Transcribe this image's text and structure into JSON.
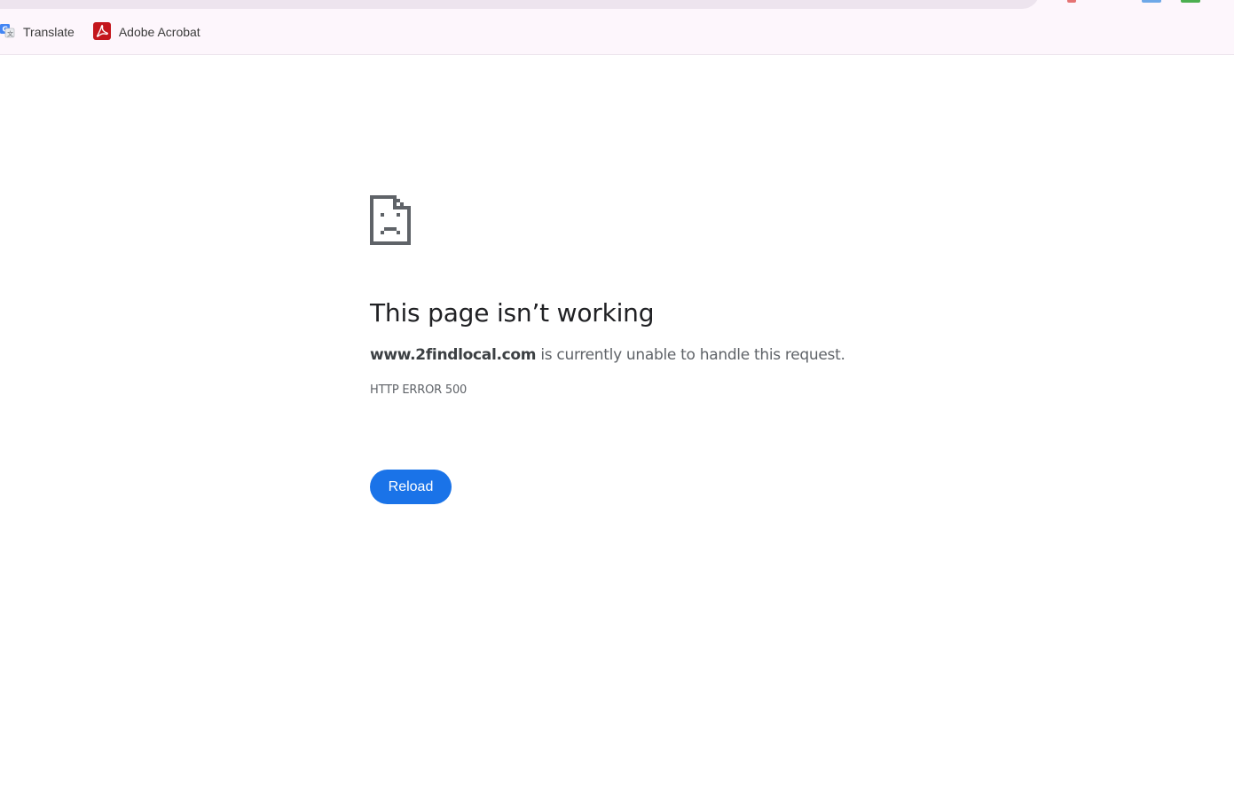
{
  "bookmarks": [
    {
      "label": "Translate",
      "icon": "google-translate-icon"
    },
    {
      "label": "Adobe Acrobat",
      "icon": "adobe-acrobat-icon"
    }
  ],
  "error": {
    "icon": "sad-page-icon",
    "title": "This page isn’t working",
    "domain": "www.2findlocal.com",
    "message_suffix": " is currently unable to handle this request.",
    "code": "HTTP ERROR 500",
    "reload_label": "Reload"
  },
  "colors": {
    "toolbar_bg": "#fdf6fc",
    "omnibox_bg": "#ede4ee",
    "title": "#202124",
    "body_text": "#5f6368",
    "button_bg": "#1a73e8",
    "button_text": "#ffffff",
    "acrobat_red": "#c4161c"
  }
}
